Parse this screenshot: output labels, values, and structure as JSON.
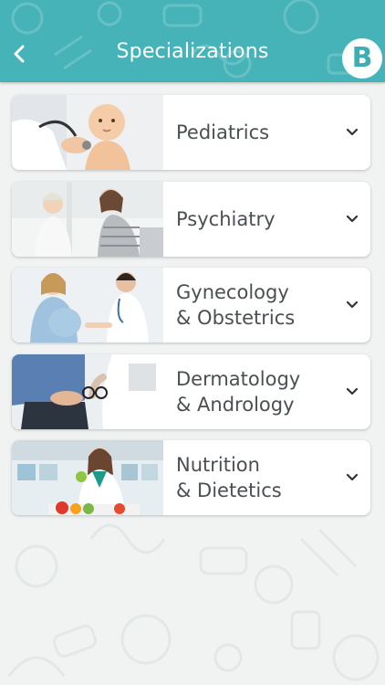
{
  "header": {
    "title": "Specializations",
    "back_icon": "chevron-left-icon",
    "logo_letter": "B",
    "color": "#46b3b8"
  },
  "specializations": [
    {
      "label": "Pediatrics",
      "image": "baby-checkup-photo"
    },
    {
      "label": "Psychiatry",
      "image": "counseling-session-photo"
    },
    {
      "label": "Gynecology\n& Obstetrics",
      "image": "pregnant-patient-photo"
    },
    {
      "label": "Dermatology\n& Andrology",
      "image": "dermatology-consult-photo"
    },
    {
      "label": "Nutrition\n& Dietetics",
      "image": "nutritionist-photo"
    }
  ],
  "expand_icon": "chevron-down-icon"
}
